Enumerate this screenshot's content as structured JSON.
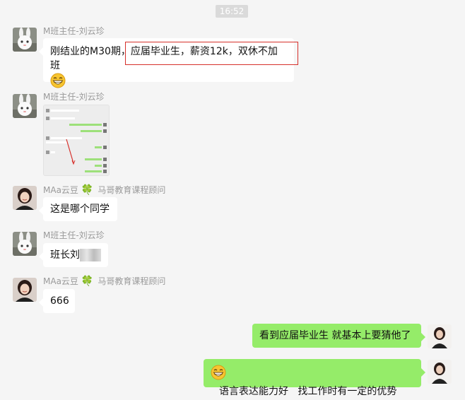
{
  "timestamp": "16:52",
  "messages": [
    {
      "sender": "M班主任-刘云珍",
      "text_part1": "刚结业的M30期，",
      "text_part2": "应届毕业生，薪资12k，双休不加班",
      "emoji": "grinning-face"
    },
    {
      "sender": "M班主任-刘云珍",
      "image_desc": "chat-screenshot-image"
    },
    {
      "sender_name": "MAa云豆",
      "sender_icon": "four-leaf-clover",
      "sender_title": "马哥教育课程顾问",
      "text": "这是哪个同学"
    },
    {
      "sender": "M班主任-刘云珍",
      "text": "班长刘"
    },
    {
      "sender_name": "MAa云豆",
      "sender_icon": "four-leaf-clover",
      "sender_title": "马哥教育课程顾问",
      "text": "666"
    },
    {
      "text": "看到应届毕业生 就基本上要猜他了"
    },
    {
      "emoji": "grinning-face",
      "text": "语言表达能力好   找工作时有一定的优势"
    }
  ],
  "colors": {
    "background": "#f5f5f5",
    "incoming_bubble": "#ffffff",
    "outgoing_bubble": "#95ec69",
    "highlight": "#d6302b",
    "sender_name": "#9a9a9a"
  }
}
